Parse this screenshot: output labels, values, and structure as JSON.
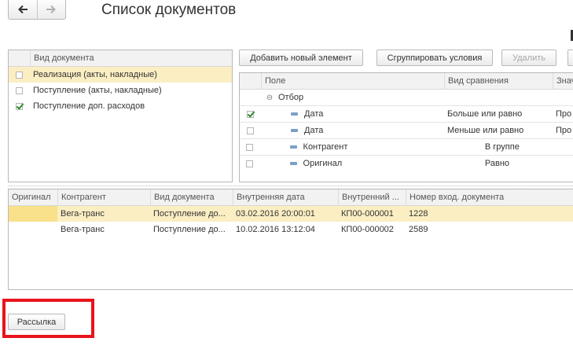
{
  "header": {
    "title": "Список документов"
  },
  "nav": {
    "back_icon": "arrow-left-icon",
    "forward_icon": "arrow-right-icon"
  },
  "doc_types": {
    "column_header": "Вид документа",
    "items": [
      {
        "label": "Реализация (акты, накладные)",
        "checked": false,
        "selected": true
      },
      {
        "label": "Поступление (акты, накладные)",
        "checked": false,
        "selected": false
      },
      {
        "label": "Поступление доп. расходов",
        "checked": true,
        "selected": false
      }
    ]
  },
  "filter_toolbar": {
    "add_label": "Добавить новый элемент",
    "group_label": "Сгруппировать условия",
    "delete_label": "Удалить"
  },
  "filter_table": {
    "headers": {
      "field": "Поле",
      "comparison": "Вид сравнения",
      "value": "Знач"
    },
    "group_label": "Отбор",
    "rows": [
      {
        "field": "Дата",
        "comparison": "Больше или равно",
        "value": "Про",
        "checked": true
      },
      {
        "field": "Дата",
        "comparison": "Меньше или равно",
        "value": "Про",
        "checked": false
      },
      {
        "field": "Контрагент",
        "comparison": "В группе",
        "value": "",
        "checked": false
      },
      {
        "field": "Оригинал",
        "comparison": "Равно",
        "value": "",
        "checked": false
      }
    ]
  },
  "documents": {
    "headers": [
      "Оригинал",
      "Контрагент",
      "Вид документа",
      "Внутренняя дата",
      "Внутренний ...",
      "Номер вход. документа"
    ],
    "rows": [
      [
        "",
        "Вега-транс",
        "Поступление до...",
        "03.02.2016 20:00:01",
        "КП00-000001",
        "1228"
      ],
      [
        "",
        "Вега-транс",
        "Поступление до...",
        "10.02.2016 13:12:04",
        "КП00-000002",
        "2589"
      ]
    ]
  },
  "footer": {
    "send_label": "Рассылка"
  },
  "colors": {
    "selected_row": "#fbeec2",
    "highlight_box": "#e8141c",
    "checkmark": "#2e8b2e"
  }
}
